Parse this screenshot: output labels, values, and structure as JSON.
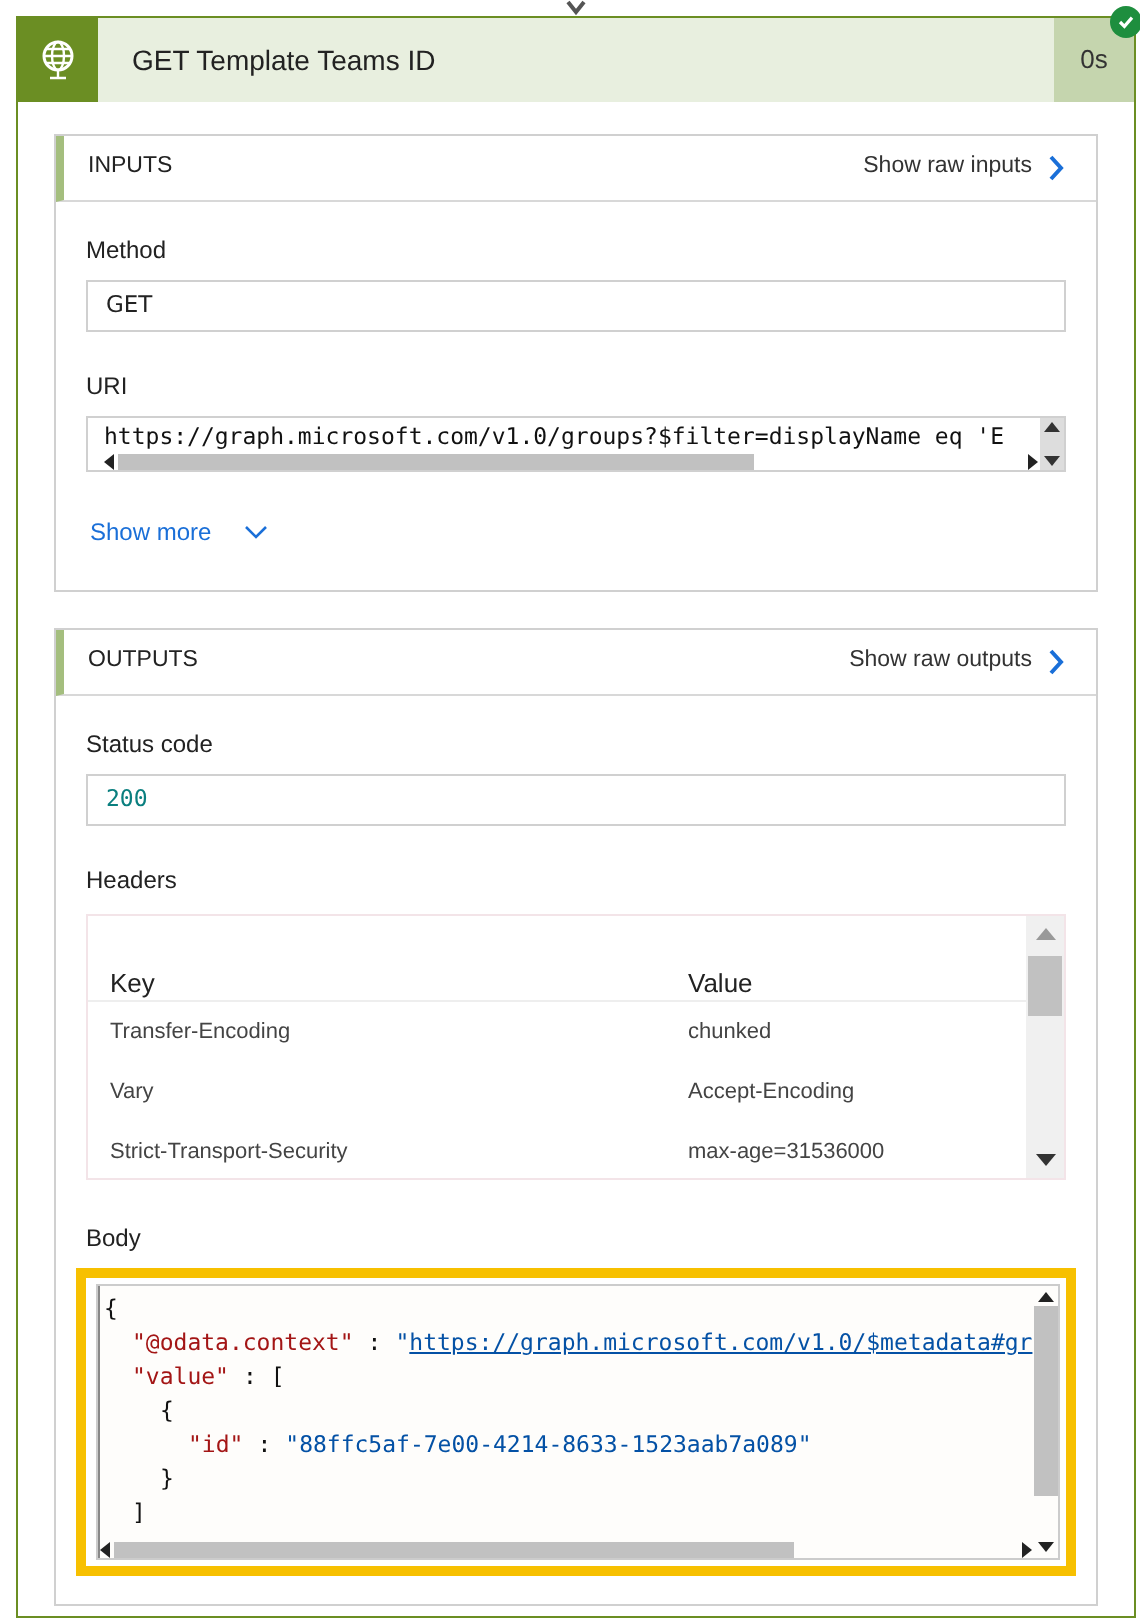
{
  "action": {
    "title": "GET Template Teams ID",
    "duration": "0s",
    "succeeded": true
  },
  "inputs": {
    "title": "INPUTS",
    "raw_link": "Show raw inputs",
    "fields": [
      {
        "label": "Method",
        "value": "GET",
        "kind": "text"
      },
      {
        "label": "URI",
        "value": "https://graph.microsoft.com/v1.0/groups?$filter=displayName eq 'E",
        "kind": "scroll"
      }
    ],
    "show_more": "Show more"
  },
  "outputs": {
    "title": "OUTPUTS",
    "raw_link": "Show raw outputs",
    "status_code": {
      "label": "Status code",
      "value": "200"
    },
    "headers": {
      "label": "Headers",
      "columns": [
        "Key",
        "Value"
      ],
      "rows": [
        [
          "Transfer-Encoding",
          "chunked"
        ],
        [
          "Vary",
          "Accept-Encoding"
        ],
        [
          "Strict-Transport-Security",
          "max-age=31536000"
        ]
      ]
    },
    "body": {
      "label": "Body",
      "highlighted": true,
      "lines": [
        {
          "tokens": [
            {
              "kind": "punct",
              "text": "{"
            }
          ],
          "children": [
            {
              "tokens": [
                {
                  "kind": "key",
                  "text": "\"@odata.context\""
                },
                {
                  "kind": "punct",
                  "text": ":"
                },
                {
                  "kind": "string",
                  "text": "\""
                },
                {
                  "kind": "link",
                  "text": "https://graph.microsoft.com/v1.0/$metadata#gr"
                }
              ]
            },
            {
              "tokens": [
                {
                  "kind": "key",
                  "text": "\"value\""
                },
                {
                  "kind": "punct",
                  "text": ": ["
                }
              ],
              "children": [
                {
                  "tokens": [
                    {
                      "kind": "punct",
                      "text": "{"
                    }
                  ],
                  "children": [
                    {
                      "tokens": [
                        {
                          "kind": "key",
                          "text": "\"id\""
                        },
                        {
                          "kind": "punct",
                          "text": ":"
                        },
                        {
                          "kind": "string",
                          "text": "\"88ffc5af-7e00-4214-8633-1523aab7a089\""
                        }
                      ]
                    }
                  ]
                },
                {
                  "tokens": [
                    {
                      "kind": "punct",
                      "text": "}"
                    }
                  ]
                }
              ]
            },
            {
              "tokens": [
                {
                  "kind": "punct",
                  "text": "]"
                }
              ]
            }
          ]
        }
      ]
    }
  }
}
